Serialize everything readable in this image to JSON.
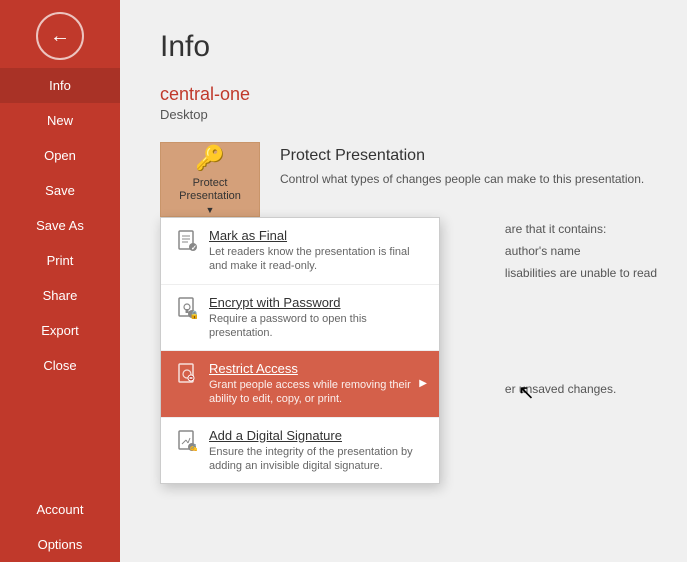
{
  "sidebar": {
    "back_icon": "←",
    "items": [
      {
        "label": "Info",
        "active": true
      },
      {
        "label": "New",
        "active": false
      },
      {
        "label": "Open",
        "active": false
      },
      {
        "label": "Save",
        "active": false
      },
      {
        "label": "Save As",
        "active": false
      },
      {
        "label": "Print",
        "active": false
      },
      {
        "label": "Share",
        "active": false
      },
      {
        "label": "Export",
        "active": false
      },
      {
        "label": "Close",
        "active": false
      }
    ],
    "bottom_items": [
      {
        "label": "Account"
      },
      {
        "label": "Options"
      }
    ]
  },
  "main": {
    "title": "Info",
    "file_title": "central-one",
    "file_location": "Desktop",
    "protect": {
      "button_icon": "🔑",
      "button_label": "Protect Presentation",
      "button_arrow": "▼",
      "heading": "Protect Presentation",
      "description": "Control what types of changes people can make to this presentation."
    },
    "dropdown": {
      "items": [
        {
          "title": "Mark as Final",
          "description": "Let readers know the presentation is final and make it read-only.",
          "highlighted": false,
          "has_arrow": false
        },
        {
          "title": "Encrypt with Password",
          "description": "Require a password to open this presentation.",
          "highlighted": false,
          "has_arrow": false
        },
        {
          "title": "Restrict Access",
          "description": "Grant people access while removing their ability to edit, copy, or print.",
          "highlighted": true,
          "has_arrow": true
        },
        {
          "title": "Add a Digital Signature",
          "description": "Ensure the integrity of the presentation by adding an invisible digital signature.",
          "highlighted": false,
          "has_arrow": false
        }
      ]
    },
    "right_info": {
      "line1": "are that it contains:",
      "line2": "author's name",
      "line3": "lisabilities are unable to read",
      "line4": "er unsaved changes."
    }
  }
}
